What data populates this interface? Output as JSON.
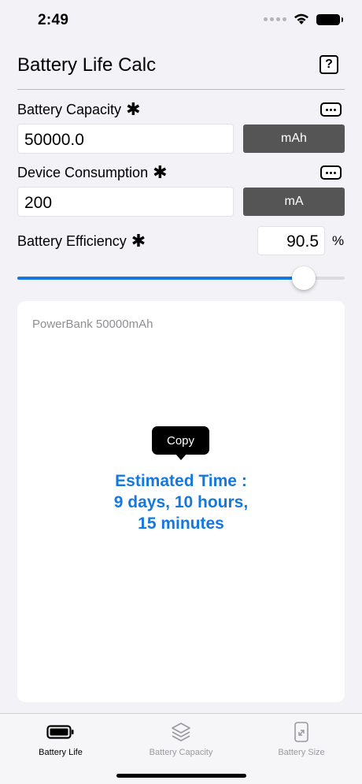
{
  "status_bar": {
    "time": "2:49"
  },
  "header": {
    "title": "Battery Life Calc",
    "help_icon": "question-mark-icon",
    "help_label": "?"
  },
  "capacity": {
    "label": "Battery Capacity",
    "asterisk": "✱",
    "value": "50000.0",
    "unit": "mAh",
    "more_icon": "more-icon"
  },
  "consumption": {
    "label": "Device Consumption",
    "asterisk": "✱",
    "value": "200",
    "unit": "mA",
    "more_icon": "more-icon"
  },
  "efficiency": {
    "label": "Battery Efficiency",
    "asterisk": "✱",
    "value": "90.5",
    "unit": "%",
    "slider_fraction": 0.875
  },
  "result": {
    "subtitle": "PowerBank 50000mAh",
    "copy_label": "Copy",
    "line1": "Estimated Time :",
    "line2": "9 days, 10 hours,",
    "line3": "15 minutes"
  },
  "tabs": [
    {
      "label": "Battery Life",
      "icon": "battery-icon",
      "active": true
    },
    {
      "label": "Battery Capacity",
      "icon": "layers-icon",
      "active": false
    },
    {
      "label": "Battery Size",
      "icon": "phone-resize-icon",
      "active": false
    }
  ],
  "colors": {
    "accent": "#1478de",
    "unit_button": "#555555",
    "background": "#f2f2f7"
  }
}
